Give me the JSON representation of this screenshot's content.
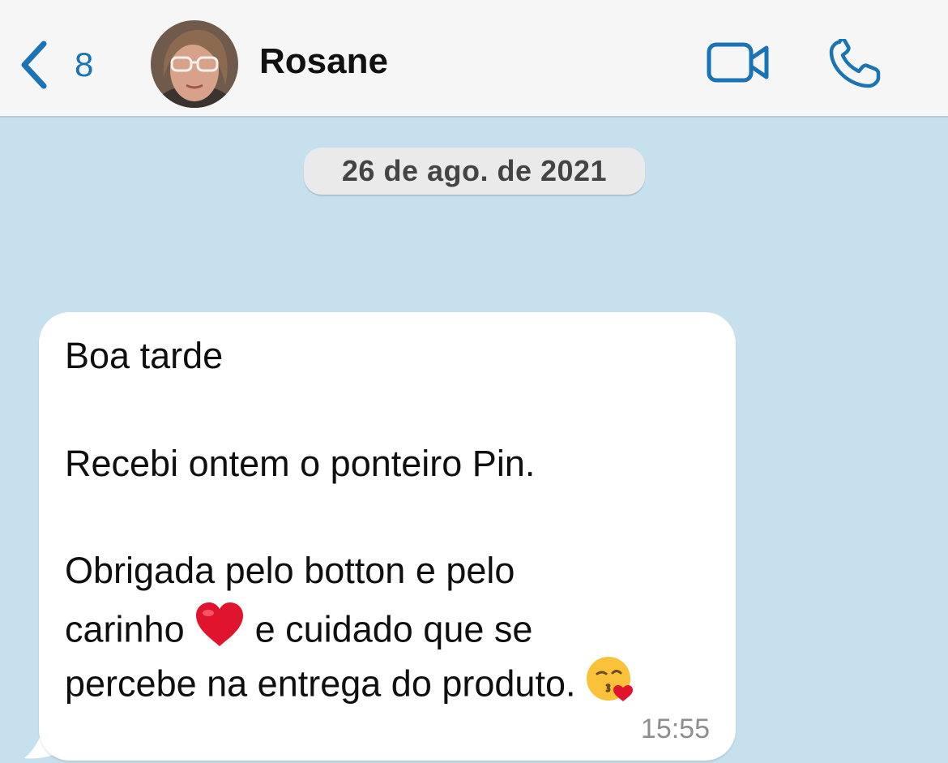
{
  "header": {
    "back_count": "8",
    "contact_name": "Rosane"
  },
  "chat": {
    "date_label": "26 de ago. de 2021",
    "message": {
      "line1": "Boa tarde",
      "line2": "Recebi ontem o ponteiro Pin.",
      "line3": "Obrigada pelo botton e pelo",
      "line4_a": "carinho",
      "line4_b": "e cuidado que se",
      "line5": "percebe na entrega do produto.",
      "time": "15:55"
    }
  },
  "icons": {
    "back": "chevron-left-icon",
    "video": "video-camera-icon",
    "call": "phone-icon",
    "emoji_heart": "red-heart-emoji",
    "emoji_kiss": "face-blowing-kiss-emoji"
  },
  "colors": {
    "accent": "#1a73b5",
    "header_bg": "#f6f6f6",
    "chat_bg": "#c6e0ee",
    "bubble_bg": "#ffffff"
  }
}
